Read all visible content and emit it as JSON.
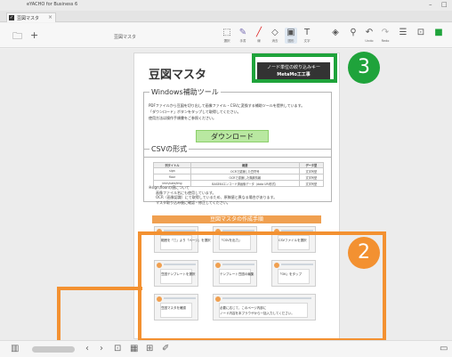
{
  "window": {
    "title": "eYACHO for Business 6",
    "controls": [
      "–",
      "□"
    ]
  },
  "tab": {
    "label": "豆図マスタ",
    "close": "×",
    "check": "✓"
  },
  "toolbar": {
    "doc_title": "豆図マスタ",
    "left_icons": [
      "folder-icon",
      "plus-icon"
    ],
    "tools": [
      {
        "name": "select",
        "glyph": "⬚",
        "caption": "選択"
      },
      {
        "name": "pen",
        "glyph": "✎",
        "caption": "手書"
      },
      {
        "name": "marker",
        "glyph": "╱",
        "caption": "線"
      },
      {
        "name": "eraser",
        "glyph": "◇",
        "caption": "消去"
      },
      {
        "name": "shape",
        "glyph": "▣",
        "caption": "図形"
      },
      {
        "name": "text",
        "glyph": "T",
        "caption": "文字"
      },
      {
        "name": "stamp",
        "glyph": "◈",
        "caption": ""
      },
      {
        "name": "pin",
        "glyph": "⚲",
        "caption": ""
      },
      {
        "name": "undo",
        "glyph": "↶",
        "caption": "Undo"
      },
      {
        "name": "redo",
        "glyph": "↷",
        "caption": "Redo"
      },
      {
        "name": "menu",
        "glyph": "☰",
        "caption": ""
      },
      {
        "name": "export",
        "glyph": "⊡",
        "caption": ""
      },
      {
        "name": "color",
        "glyph": "■",
        "caption": ""
      }
    ]
  },
  "page": {
    "title": "豆図マスタ",
    "filter_box": {
      "line1": "ノード単位の絞り込みキー",
      "line2": "MetaMo工工事"
    },
    "windows_tool": {
      "heading": "Windows補助ツール",
      "text1": "PDFファイルから豆図を切り出して画像ファイル・CSVに変換する補助ツールを提供しています。",
      "text2": "「ダウンロード」ボタンをタップして取得してください。",
      "text3": "使用方法は操作手順書をご参照ください。",
      "download_label": "ダウンロード"
    },
    "csv": {
      "heading": "CSVの形式",
      "columns": [
        "列タイトル",
        "概要",
        "データ型"
      ],
      "rows": [
        [
          "sign",
          "OCRで認識した豆符号",
          "文字列型"
        ],
        [
          "floor",
          "OCRで認識した階層情報",
          "文字列型"
        ],
        [
          "imm/cate/img",
          "BASE64エンコード済画像データ（data URI形式）",
          "文字列型"
        ]
      ],
      "note1": "※sign,floorの値について",
      "note2": "画像ファイル名にも使用しています。",
      "note3": "OCR（画像認識）にて取得しているため、原稿値と異なる場合があります。",
      "note4": "マスタ取り込み後に確認・修正してください。"
    },
    "procedure": {
      "heading": "豆図マスタの作成手順",
      "steps": [
        "範囲を「□」より「ページ」を選択",
        "「CSVを出力」",
        "CSVファイルを選択",
        "豆図テンプレートを選択",
        "テンプレート豆図の編集",
        "「OK」をタップ",
        "豆図マスタを確認",
        "必要に応じて、このページ内部に",
        ""
      ],
      "footer": "ノード内容を本ブラウザから一括入力してください。"
    }
  },
  "callouts": {
    "two": "2",
    "three": "3"
  },
  "colors": {
    "orange": "#f39131",
    "green": "#1fa33b",
    "download_bg": "#b9e8a1"
  },
  "bottombar": {
    "icons": [
      "book-icon",
      "prev-icon",
      "next-icon",
      "fit-page-icon",
      "calendar-icon",
      "grid-icon",
      "pen-icon",
      "panel-icon"
    ]
  }
}
